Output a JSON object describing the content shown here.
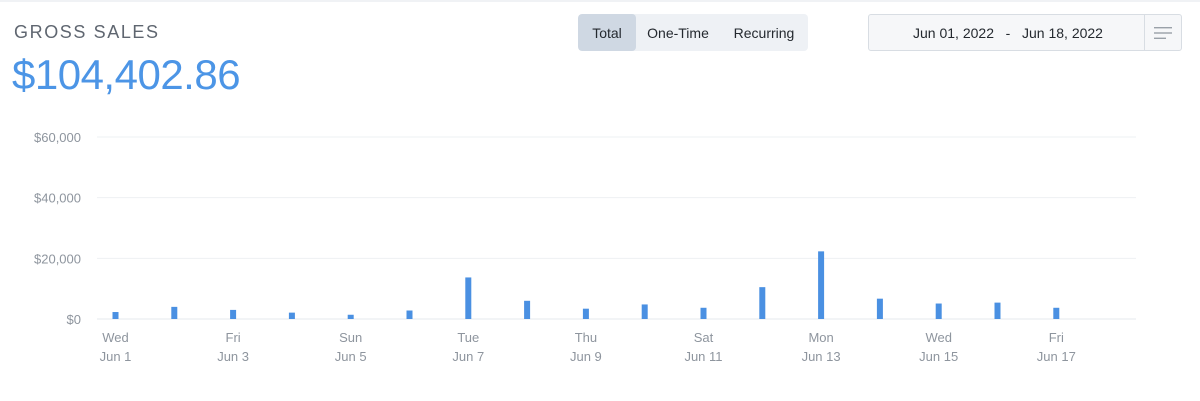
{
  "header": {
    "label": "GROSS SALES",
    "amount": "$104,402.86"
  },
  "tabs": [
    {
      "label": "Total",
      "active": true
    },
    {
      "label": "One-Time",
      "active": false
    },
    {
      "label": "Recurring",
      "active": false
    }
  ],
  "date_range": {
    "start": "Jun 01, 2022",
    "separator": "-",
    "end": "Jun 18, 2022",
    "menu_icon": "hamburger-icon"
  },
  "colors": {
    "accent": "#4c95e6",
    "bar": "#4a90e2",
    "grid": "#eef0f3",
    "tick_text": "#8e959e"
  },
  "chart_data": {
    "type": "bar",
    "ylim": [
      0,
      60000
    ],
    "yticks": [
      0,
      20000,
      40000,
      60000
    ],
    "ytick_labels": [
      "$0",
      "$20,000",
      "$40,000",
      "$60,000"
    ],
    "grid": true,
    "categories": [
      "Jun 1",
      "Jun 2",
      "Jun 3",
      "Jun 4",
      "Jun 5",
      "Jun 6",
      "Jun 7",
      "Jun 8",
      "Jun 9",
      "Jun 10",
      "Jun 11",
      "Jun 12",
      "Jun 13",
      "Jun 14",
      "Jun 15",
      "Jun 16",
      "Jun 17"
    ],
    "values": [
      2300,
      4000,
      3000,
      2100,
      1400,
      2800,
      13700,
      6000,
      3400,
      4800,
      3700,
      10500,
      22300,
      6700,
      5100,
      5400,
      3700
    ],
    "x_tick_labels": [
      {
        "day": "Wed",
        "date": "Jun 1"
      },
      {
        "day": "Fri",
        "date": "Jun 3"
      },
      {
        "day": "Sun",
        "date": "Jun 5"
      },
      {
        "day": "Tue",
        "date": "Jun 7"
      },
      {
        "day": "Thu",
        "date": "Jun 9"
      },
      {
        "day": "Sat",
        "date": "Jun 11"
      },
      {
        "day": "Mon",
        "date": "Jun 13"
      },
      {
        "day": "Wed",
        "date": "Jun 15"
      },
      {
        "day": "Fri",
        "date": "Jun 17"
      }
    ],
    "x_tick_categories": [
      "Jun 1",
      "Jun 3",
      "Jun 5",
      "Jun 7",
      "Jun 9",
      "Jun 11",
      "Jun 13",
      "Jun 15",
      "Jun 17"
    ]
  }
}
